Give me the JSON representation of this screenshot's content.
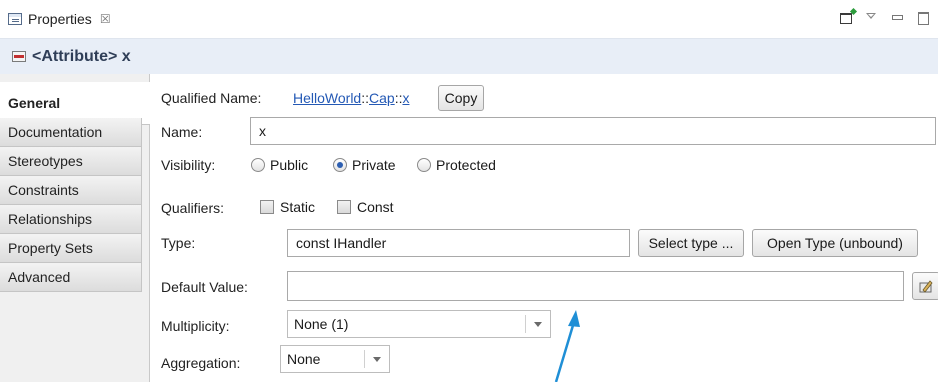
{
  "view": {
    "tab_label": "Properties",
    "close_glyph": "☒"
  },
  "header": {
    "title": "<Attribute> x"
  },
  "tabs": [
    {
      "label": "General"
    },
    {
      "label": "Documentation"
    },
    {
      "label": "Stereotypes"
    },
    {
      "label": "Constraints"
    },
    {
      "label": "Relationships"
    },
    {
      "label": "Property Sets"
    },
    {
      "label": "Advanced"
    }
  ],
  "form": {
    "qualified_name_label": "Qualified Name:",
    "qualified_name_part1": "HelloWorld",
    "qualified_name_sep1": "::",
    "qualified_name_part2": "Cap",
    "qualified_name_sep2": "::",
    "qualified_name_part3": "x",
    "copy_button": "Copy",
    "name_label": "Name:",
    "name_value": "x",
    "visibility_label": "Visibility:",
    "visibility_options": [
      "Public",
      "Private",
      "Protected"
    ],
    "visibility_selected": "Private",
    "qualifiers_label": "Qualifiers:",
    "qualifier_static": "Static",
    "qualifier_const": "Const",
    "type_label": "Type:",
    "type_value": "const IHandler",
    "select_type_button": "Select type ...",
    "open_type_button": "Open Type (unbound)",
    "default_value_label": "Default Value:",
    "default_value": "",
    "multiplicity_label": "Multiplicity:",
    "multiplicity_value": "None (1)",
    "aggregation_label": "Aggregation:",
    "aggregation_value": "None"
  },
  "colors": {
    "accent": "#2d5fb1",
    "link": "#2459b5",
    "header_bg": "#e8eef7",
    "annotation_arrow": "#1f8fd6"
  },
  "icons": {
    "view": "properties-view-icon",
    "attribute": "attribute-icon",
    "new_window": "new-window-icon",
    "view_menu": "view-menu-icon",
    "minimize": "minimize-icon",
    "maximize": "maximize-icon",
    "default_value_editor": "expression-editor-icon"
  }
}
